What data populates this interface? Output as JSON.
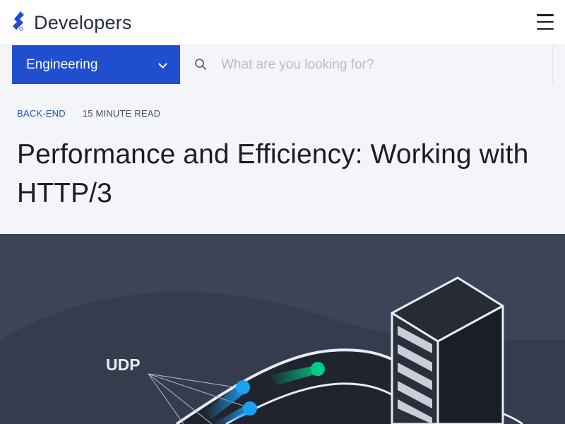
{
  "header": {
    "brand_name": "Developers",
    "logo_icon": "toptal-logo-icon",
    "menu_icon": "hamburger-menu-icon"
  },
  "filter": {
    "category_label": "Engineering",
    "category_icon": "chevron-down-icon",
    "search_placeholder": "What are you looking for?",
    "search_value": "",
    "search_icon": "search-icon"
  },
  "article": {
    "category": "BACK-END",
    "read_time": "15 MINUTE READ",
    "title": "Performance and Efficiency: Working with HTTP/3"
  },
  "hero": {
    "udp_label": "UDP"
  },
  "colors": {
    "brand_blue": "#204ecf",
    "page_gray": "#f4f5f8",
    "hero_bg": "#3c4558",
    "title_text": "#1b1d24",
    "accent_green": "#00cc83",
    "accent_cyan": "#1ba1f2"
  }
}
